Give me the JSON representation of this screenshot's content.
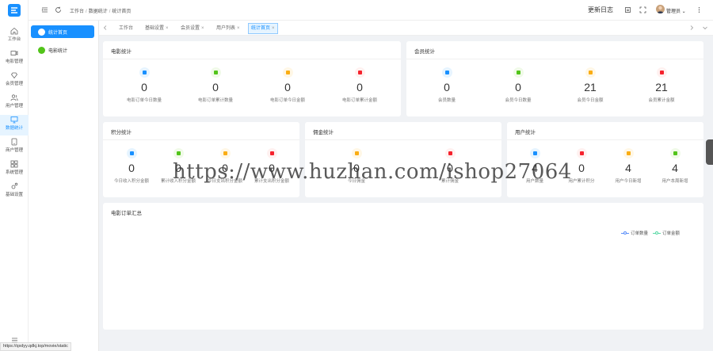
{
  "sidebar": {
    "items": [
      {
        "label": "工作台",
        "icon": "home-icon"
      },
      {
        "label": "电影管理",
        "icon": "video-icon"
      },
      {
        "label": "会员管理",
        "icon": "diamond-icon"
      },
      {
        "label": "用户管理",
        "icon": "users-icon"
      },
      {
        "label": "数据统计",
        "icon": "monitor-icon"
      },
      {
        "label": "商户管理",
        "icon": "tablet-icon"
      },
      {
        "label": "系统管理",
        "icon": "grid-icon"
      },
      {
        "label": "基础设置",
        "icon": "settings-icon"
      }
    ],
    "active_index": 4
  },
  "submenu": {
    "items": [
      {
        "label": "统计首页",
        "active": true
      },
      {
        "label": "电影统计",
        "active": false
      }
    ]
  },
  "header": {
    "breadcrumb": [
      "工作台",
      "数据统计",
      "统计首页"
    ],
    "changelog": "更新日志",
    "user": "管理员"
  },
  "tabs": [
    {
      "label": "工作台",
      "closable": false
    },
    {
      "label": "基础设置",
      "closable": true
    },
    {
      "label": "会员设置",
      "closable": true
    },
    {
      "label": "用户列表",
      "closable": true
    },
    {
      "label": "统计首页",
      "closable": true,
      "active": true
    }
  ],
  "cards": {
    "movie": {
      "title": "电影统计",
      "stats": [
        {
          "value": "0",
          "label": "电影订单今日数量",
          "color": "#1890ff"
        },
        {
          "value": "0",
          "label": "电影订单累计数量",
          "color": "#52c41a"
        },
        {
          "value": "0",
          "label": "电影订单今日金额",
          "color": "#faad14"
        },
        {
          "value": "0",
          "label": "电影订单累计金额",
          "color": "#f5222d"
        }
      ]
    },
    "member": {
      "title": "会员统计",
      "stats": [
        {
          "value": "0",
          "label": "会员数量",
          "color": "#1890ff"
        },
        {
          "value": "0",
          "label": "会员今日数量",
          "color": "#52c41a"
        },
        {
          "value": "21",
          "label": "会员今日金额",
          "color": "#faad14"
        },
        {
          "value": "21",
          "label": "会员累计金额",
          "color": "#f5222d"
        }
      ]
    },
    "points": {
      "title": "积分统计",
      "stats": [
        {
          "value": "0",
          "label": "今日收入积分金额",
          "color": "#1890ff"
        },
        {
          "value": "0",
          "label": "累计收入积分金额",
          "color": "#52c41a"
        },
        {
          "value": "0",
          "label": "今日支出积分金额",
          "color": "#faad14"
        },
        {
          "value": "0",
          "label": "累计支出积分金额",
          "color": "#f5222d"
        }
      ]
    },
    "commission": {
      "title": "佣金统计",
      "stats": [
        {
          "value": "0",
          "label": "今日佣金",
          "color": "#faad14"
        },
        {
          "value": "0",
          "label": "累计佣金",
          "color": "#f5222d"
        }
      ]
    },
    "user": {
      "title": "用户统计",
      "stats": [
        {
          "value": "4",
          "label": "用户数量",
          "color": "#1890ff"
        },
        {
          "value": "0",
          "label": "用户累计积分",
          "color": "#f5222d"
        },
        {
          "value": "4",
          "label": "用户今日新增",
          "color": "#faad14"
        },
        {
          "value": "4",
          "label": "用户本周新增",
          "color": "#52c41a"
        }
      ]
    },
    "orders": {
      "title": "电影订单汇总",
      "legend": [
        {
          "label": "订单数量",
          "color": "#5b8ff9"
        },
        {
          "label": "订单金额",
          "color": "#5ad8a6"
        }
      ]
    }
  },
  "watermark": "https://www.huzhan.com/ishop27064",
  "status_url": "https://qxdyy.qdkj.top/movie/static"
}
